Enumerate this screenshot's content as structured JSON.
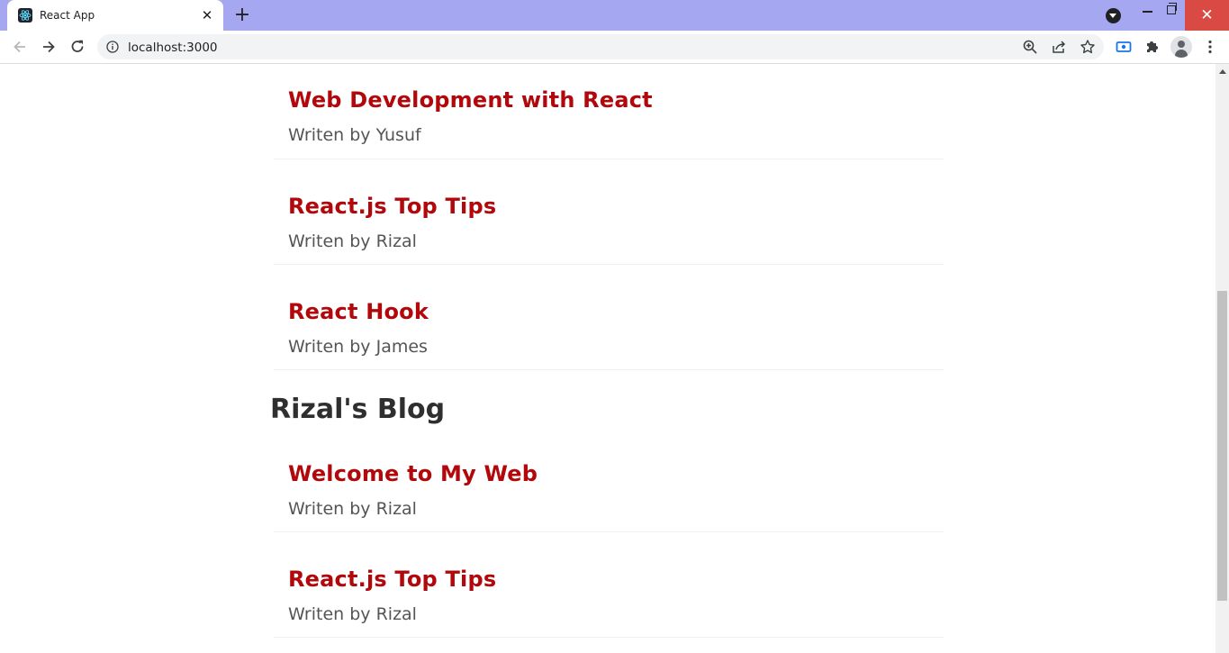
{
  "browser": {
    "tab_title": "React App",
    "tab_close": "✕",
    "new_tab": "+",
    "url": "localhost:3000",
    "window_close": "✕",
    "accent_color": "#a5a8f1"
  },
  "page": {
    "first_list": [
      {
        "title": "Web Development with React",
        "author": "Writen by Yusuf"
      },
      {
        "title": "React.js Top Tips",
        "author": "Writen by Rizal"
      },
      {
        "title": "React Hook",
        "author": "Writen by James"
      }
    ],
    "second_heading": "Rizal's Blog",
    "second_list": [
      {
        "title": "Welcome to My Web",
        "author": "Writen by Rizal"
      },
      {
        "title": "React.js Top Tips",
        "author": "Writen by Rizal"
      }
    ],
    "title_color": "#b3080b",
    "author_color": "#555555"
  },
  "icons": {
    "back": "back-arrow-icon",
    "forward": "forward-arrow-icon",
    "reload": "reload-icon",
    "info": "info-icon",
    "zoom": "zoom-icon",
    "share": "share-icon",
    "bookmark": "star-icon",
    "screen_capture": "screen-capture-icon",
    "extensions": "puzzle-icon",
    "profile": "profile-avatar-icon",
    "menu": "kebab-menu-icon"
  }
}
